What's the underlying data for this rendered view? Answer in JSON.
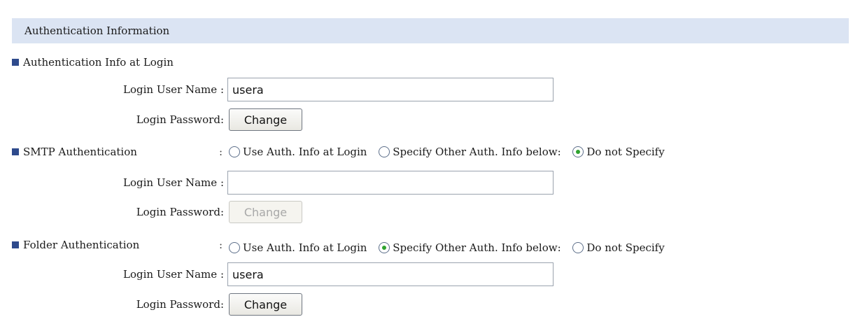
{
  "header": {
    "title": "Authentication Information"
  },
  "login_auth": {
    "title": "Authentication Info at Login",
    "user_name_label": "Login User Name",
    "user_name_value": "usera",
    "password_label": "Login Password",
    "change_label": "Change"
  },
  "smtp_auth": {
    "title": "SMTP Authentication",
    "colon": ":",
    "options": [
      {
        "label": "Use Auth. Info at Login",
        "selected": false
      },
      {
        "label": "Specify Other Auth. Info below:",
        "selected": false
      },
      {
        "label": "Do not Specify",
        "selected": true
      }
    ],
    "user_name_label": "Login User Name",
    "user_name_value": "",
    "password_label": "Login Password",
    "change_label": "Change",
    "change_enabled": false
  },
  "folder_auth": {
    "title": "Folder Authentication",
    "colon": ":",
    "options": [
      {
        "label": "Use Auth. Info at Login",
        "selected": false
      },
      {
        "label": "Specify Other Auth. Info below:",
        "selected": true
      },
      {
        "label": "Do not Specify",
        "selected": false
      }
    ],
    "user_name_label": "Login User Name",
    "user_name_value": "usera",
    "password_label": "Login Password",
    "change_label": "Change",
    "change_enabled": true
  },
  "label_suffix": ":"
}
